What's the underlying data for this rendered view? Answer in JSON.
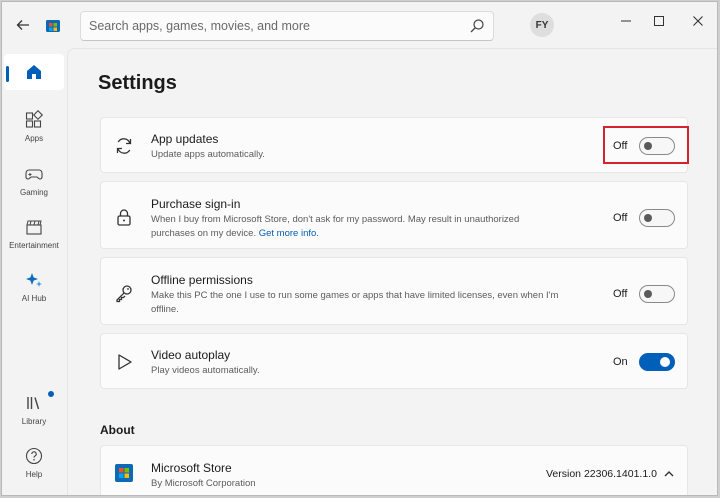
{
  "search": {
    "placeholder": "Search apps, games, movies, and more"
  },
  "user": {
    "initials": "FY"
  },
  "sidebar": {
    "items": [
      {
        "label": "Home"
      },
      {
        "label": "Apps"
      },
      {
        "label": "Gaming"
      },
      {
        "label": "Entertainment"
      },
      {
        "label": "AI Hub"
      },
      {
        "label": "Library"
      },
      {
        "label": "Help"
      }
    ]
  },
  "page": {
    "title": "Settings"
  },
  "settings": [
    {
      "title": "App updates",
      "description": "Update apps automatically.",
      "state": "Off",
      "on": false
    },
    {
      "title": "Purchase sign-in",
      "description": "When I buy from Microsoft Store, don't ask for my password. May result in unauthorized purchases on my device.",
      "link": "Get more info.",
      "state": "Off",
      "on": false
    },
    {
      "title": "Offline permissions",
      "description": "Make this PC the one I use to run some games or apps that have limited licenses, even when I'm offline.",
      "state": "Off",
      "on": false
    },
    {
      "title": "Video autoplay",
      "description": "Play videos automatically.",
      "state": "On",
      "on": true
    }
  ],
  "about": {
    "section_title": "About",
    "app_name": "Microsoft Store",
    "publisher": "By Microsoft Corporation",
    "version": "Version 22306.1401.1.0"
  },
  "colors": {
    "accent": "#005fb8",
    "highlight": "#d1242f"
  },
  "icons": {
    "back": "arrow-left-icon",
    "search": "magnifier-icon",
    "minimize": "minimize-icon",
    "maximize": "maximize-icon",
    "close": "close-icon"
  }
}
